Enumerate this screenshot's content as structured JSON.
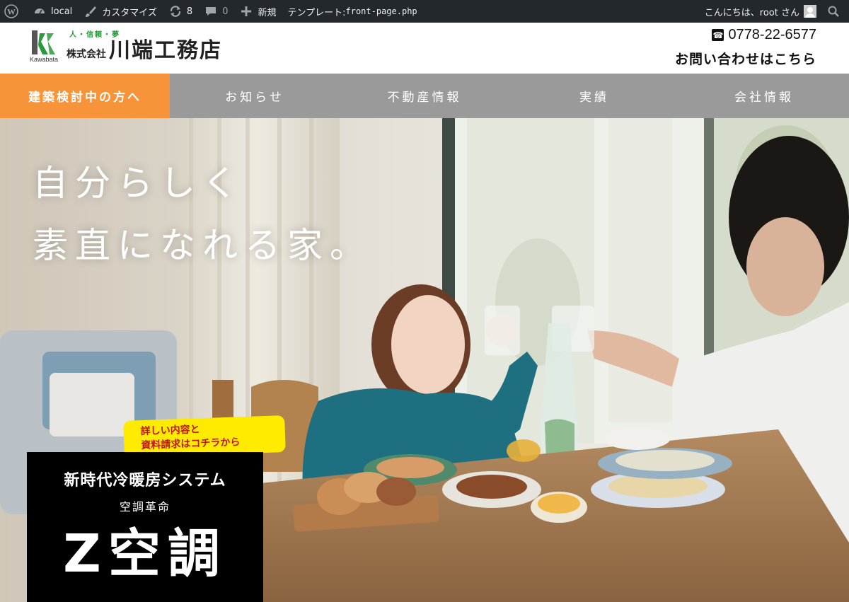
{
  "adminbar": {
    "site": "local",
    "customize": "カスタマイズ",
    "updates": "8",
    "comments": "0",
    "new": "新規",
    "template": "テンプレート:",
    "template_file": "front-page.php",
    "greeting": "こんにちは、root さん"
  },
  "header": {
    "logo_sub": "Kawabata",
    "tagline": "人・信頼・夢",
    "company_prefix": "株式会社",
    "company_name": "川端工務店",
    "phone": "0778-22-6577",
    "inquiry": "お問い合わせはこちら"
  },
  "nav": {
    "items": [
      {
        "label": "建築検討中の方へ"
      },
      {
        "label": "お知らせ"
      },
      {
        "label": "不動産情報"
      },
      {
        "label": "実績"
      },
      {
        "label": "会社情報"
      }
    ]
  },
  "hero": {
    "title_line1": "自分らしく",
    "title_line2": "素直になれる家。"
  },
  "promo": {
    "bubble_line1": "詳しい内容と",
    "bubble_line2": "資料請求はコチラから",
    "heading": "新時代冷暖房システム",
    "sub": "空調革命",
    "product": "Z空調"
  },
  "colors": {
    "adminbar": "#23282d",
    "nav": "#9a9a9a",
    "accent": "#f7943a",
    "logo_green": "#2a9b3c",
    "bubble": "#ffeb00"
  }
}
